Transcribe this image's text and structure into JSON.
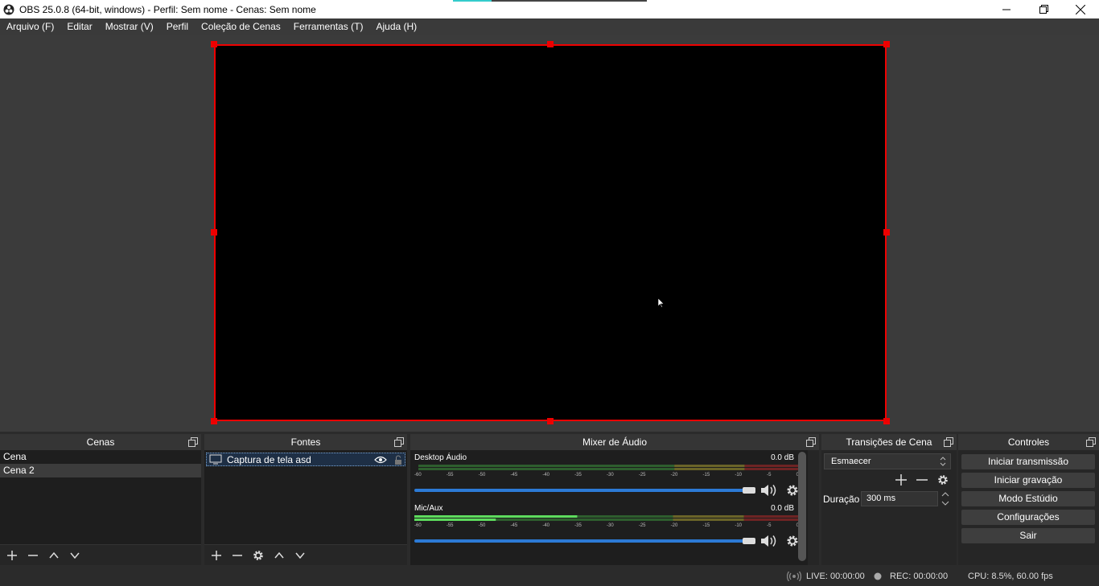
{
  "window": {
    "title": "OBS 25.0.8 (64-bit, windows) - Perfil: Sem nome - Cenas: Sem nome"
  },
  "menu": [
    {
      "label": "Arquivo (F)"
    },
    {
      "label": "Editar"
    },
    {
      "label": "Mostrar (V)"
    },
    {
      "label": "Perfil"
    },
    {
      "label": "Coleção de Cenas"
    },
    {
      "label": "Ferramentas (T)"
    },
    {
      "label": "Ajuda (H)"
    }
  ],
  "scenes": {
    "title": "Cenas",
    "items": [
      {
        "label": "Cena"
      },
      {
        "label": "Cena 2"
      }
    ]
  },
  "sources": {
    "title": "Fontes",
    "items": [
      {
        "label": "Captura de tela asd"
      }
    ]
  },
  "mixer": {
    "title": "Mixer de Áudio",
    "ticks": [
      "-60",
      "-55",
      "-50",
      "-45",
      "-40",
      "-35",
      "-30",
      "-25",
      "-20",
      "-15",
      "-10",
      "-5",
      "0"
    ],
    "channels": [
      {
        "name": "Desktop Áudio",
        "db": "0.0 dB",
        "level": 0,
        "volume": 1.0
      },
      {
        "name": "Mic/Aux",
        "db": "0.0 dB",
        "level": 0.42,
        "volume": 1.0
      }
    ]
  },
  "transitions": {
    "title": "Transições de Cena",
    "selected": "Esmaecer",
    "duration_label": "Duração",
    "duration_value": "300 ms"
  },
  "controls": {
    "title": "Controles",
    "buttons": [
      {
        "label": "Iniciar transmissão"
      },
      {
        "label": "Iniciar gravação"
      },
      {
        "label": "Modo Estúdio"
      },
      {
        "label": "Configurações"
      },
      {
        "label": "Sair"
      }
    ]
  },
  "status": {
    "live": "LIVE: 00:00:00",
    "rec": "REC: 00:00:00",
    "cpu": "CPU: 8.5%, 60.00 fps"
  },
  "colors": {
    "selection_border": "#e00000",
    "meter_green": "#4caf50",
    "fader_blue": "#2c7ad6"
  }
}
